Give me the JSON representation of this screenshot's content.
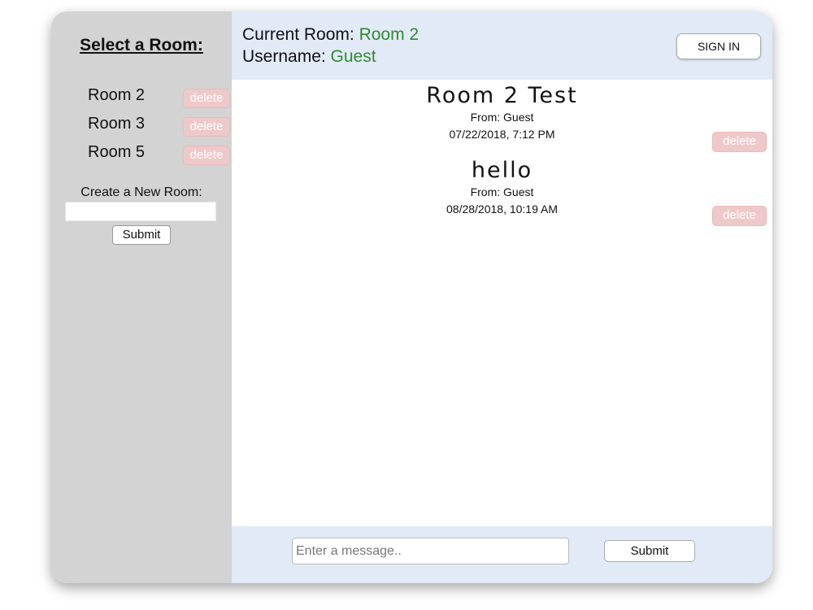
{
  "sidebar": {
    "title": "Select a Room:",
    "rooms": [
      {
        "name": "Room 2",
        "delete_label": "delete"
      },
      {
        "name": "Room 3",
        "delete_label": "delete"
      },
      {
        "name": "Room 5",
        "delete_label": "delete"
      }
    ],
    "create_label": "Create a New Room:",
    "create_input_value": "",
    "create_submit_label": "Submit"
  },
  "header": {
    "current_room_label": "Current Room",
    "current_room_value": "Room 2",
    "username_label": "Username",
    "username_value": "Guest",
    "sign_in_label": "SIGN IN"
  },
  "messages": [
    {
      "text": "Room 2 Test",
      "from": "From: Guest",
      "timestamp": "07/22/2018, 7:12 PM",
      "delete_label": "delete"
    },
    {
      "text": "hello",
      "from": "From: Guest",
      "timestamp": "08/28/2018, 10:19 AM",
      "delete_label": "delete"
    }
  ],
  "footer": {
    "message_placeholder": "Enter a message..",
    "submit_label": "Submit"
  },
  "colors": {
    "sidebar_bg": "#d3d3d3",
    "header_bg": "#e2eaf7",
    "accent_green": "#2e8b2e",
    "delete_bg": "#efc9c9"
  }
}
